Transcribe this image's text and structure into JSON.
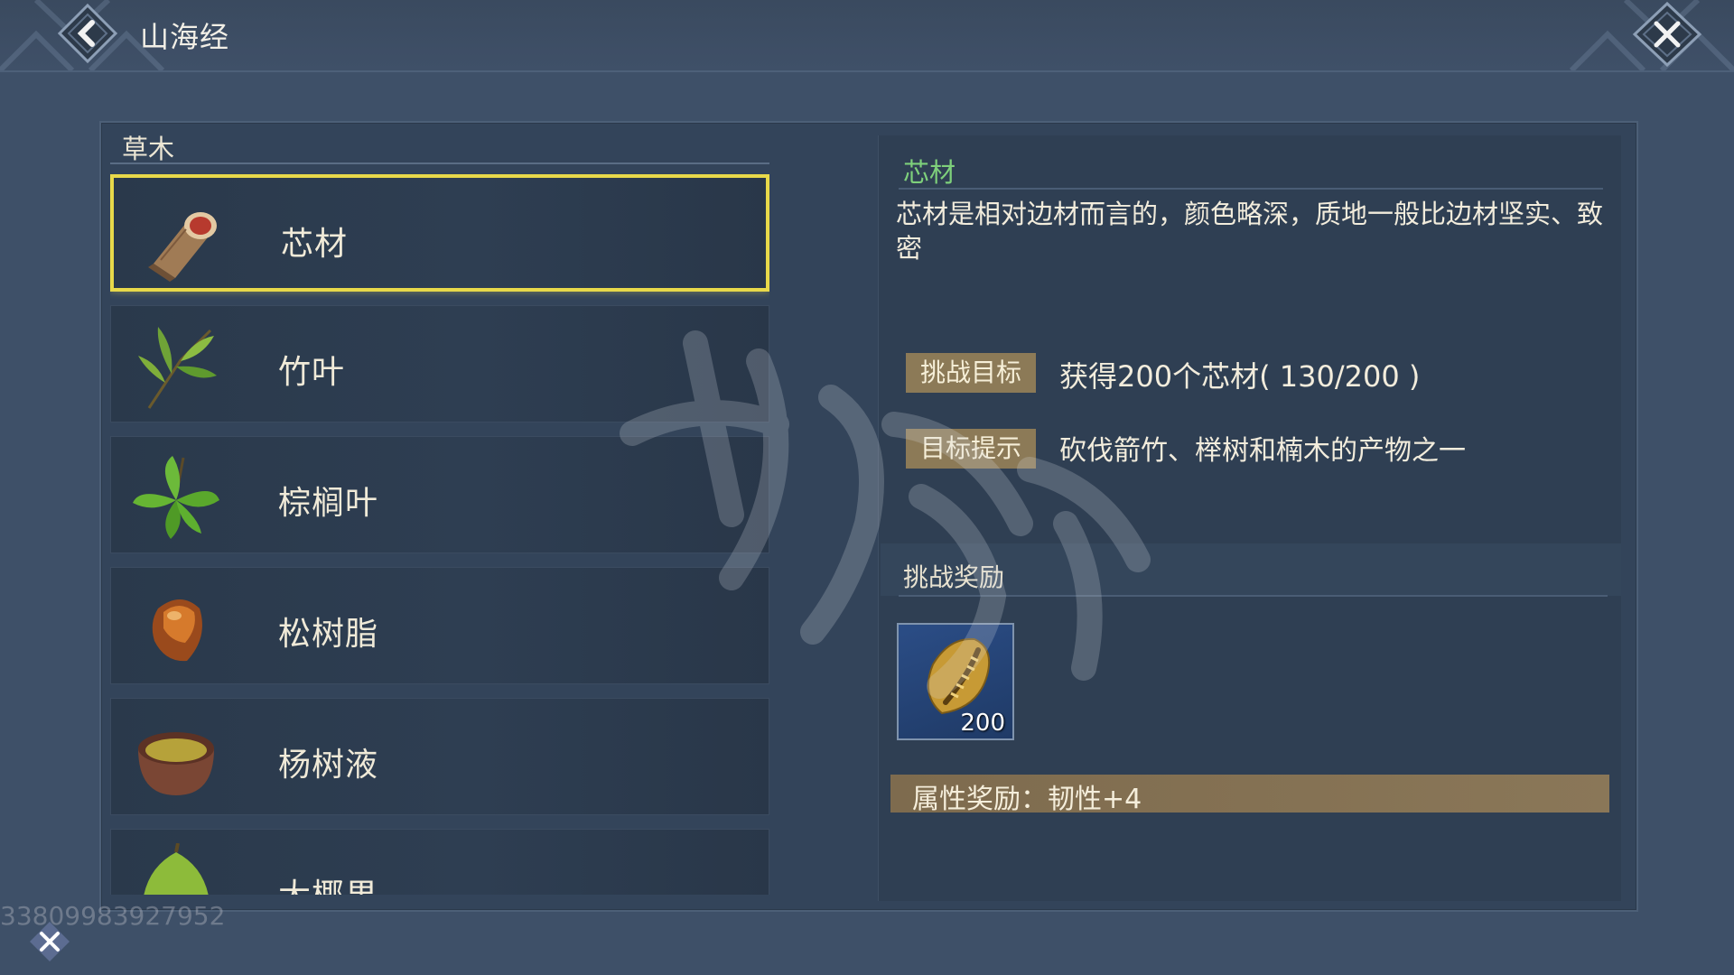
{
  "header": {
    "title": "山海经"
  },
  "category": {
    "label": "草木"
  },
  "items": [
    {
      "label": "芯材",
      "icon": "log-icon",
      "selected": true
    },
    {
      "label": "竹叶",
      "icon": "bamboo-leaf-icon"
    },
    {
      "label": "棕榈叶",
      "icon": "palm-leaf-icon"
    },
    {
      "label": "松树脂",
      "icon": "resin-icon"
    },
    {
      "label": "杨树液",
      "icon": "sap-bowl-icon"
    },
    {
      "label": "大椰果",
      "icon": "coconut-icon"
    }
  ],
  "detail": {
    "name": "芯材",
    "description": "芯材是相对边材而言的，颜色略深，质地一般比边材坚实、致密",
    "goal_tag": "挑战目标",
    "goal_text": "获得200个芯材(  130/200  )",
    "hint_tag": "目标提示",
    "hint_text": "砍伐箭竹、榉树和楠木的产物之一",
    "reward_title": "挑战奖励",
    "reward_qty": "200",
    "reward_icon": "cowrie-shell-icon",
    "attr_text": "属性奖励：韧性+4"
  },
  "overlay": {
    "uid": "3380998392795​2"
  },
  "colors": {
    "selected_border": "#e8d94a",
    "item_name": "#7ed07b",
    "tag_bg": "#8c7a57",
    "reward_slot": "#2b4d86"
  }
}
